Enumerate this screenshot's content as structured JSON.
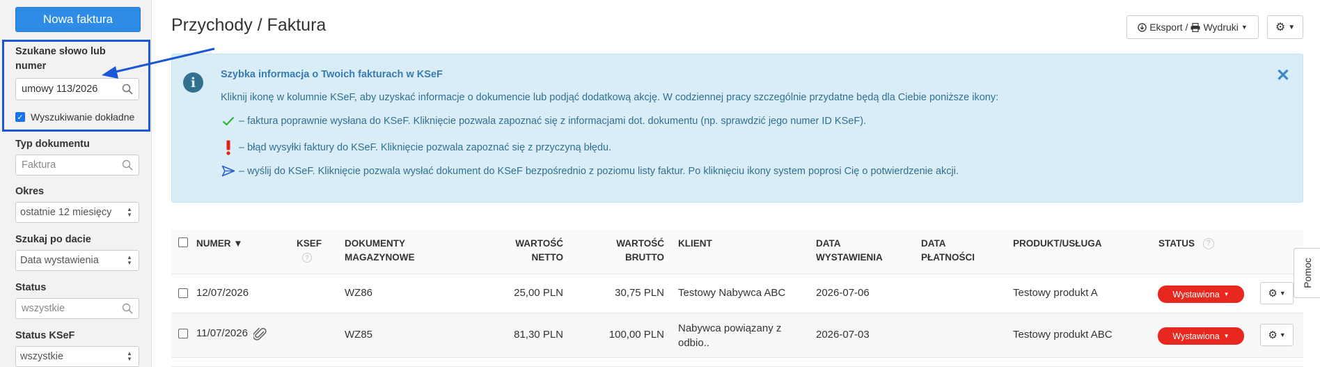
{
  "sidebar": {
    "new_invoice_label": "Nowa faktura",
    "search": {
      "label_line1": "Szukane słowo lub",
      "label_line2": "numer",
      "value": "umowy 113/2026",
      "exact_label": "Wyszukiwanie dokładne",
      "exact_checked": true
    },
    "doc_type": {
      "label": "Typ dokumentu",
      "placeholder": "Faktura"
    },
    "period": {
      "label": "Okres",
      "value": "ostatnie 12 miesięcy"
    },
    "date_search": {
      "label": "Szukaj po dacie",
      "value": "Data wystawienia"
    },
    "status": {
      "label": "Status",
      "placeholder": "wszystkie"
    },
    "ksef_status": {
      "label": "Status KSeF",
      "value": "wszystkie"
    }
  },
  "header": {
    "title": "Przychody / Faktura",
    "export_label": "Eksport / ",
    "print_label": "Wydruki"
  },
  "info": {
    "title": "Szybka informacja o Twoich fakturach w KSeF",
    "intro": "Kliknij ikonę w kolumnie KSeF, aby uzyskać informacje o dokumencie lub podjąć dodatkową akcję. W codziennej pracy szczególnie przydatne będą dla Ciebie poniższe ikony:",
    "line_ok": "– faktura poprawnie wysłana do KSeF. Kliknięcie pozwala zapoznać się z informacjami dot. dokumentu (np. sprawdzić jego numer ID KSeF).",
    "line_error": "– błąd wysyłki faktury do KSeF. Kliknięcie pozwala zapoznać się z przyczyną błędu.",
    "line_send": "– wyślij do KSeF. Kliknięcie pozwala wysłać dokument do KSeF bezpośrednio z poziomu listy faktur. Po kliknięciu ikony system poprosi Cię o potwierdzenie akcji.",
    "colors": {
      "ok": "#2fb52f",
      "error": "#e0201a",
      "send": "#2a5bd7"
    }
  },
  "table": {
    "headers": {
      "numer": "NUMER ▼",
      "ksef": "KSEF",
      "dok_line1": "DOKUMENTY",
      "dok_line2": "MAGAZYNOWE",
      "netto_line1": "WARTOŚĆ",
      "netto_line2": "NETTO",
      "brutto_line1": "WARTOŚĆ",
      "brutto_line2": "BRUTTO",
      "klient": "KLIENT",
      "data_wyst_line1": "DATA",
      "data_wyst_line2": "WYSTAWIENIA",
      "data_plat_line1": "DATA",
      "data_plat_line2": "PŁATNOŚCI",
      "produkt": "PRODUKT/USŁUGA",
      "status": "STATUS"
    },
    "rows": [
      {
        "numer": "12/07/2026",
        "dok": "WZ86",
        "netto": "25,00 PLN",
        "brutto": "30,75 PLN",
        "klient_line1": "Testowy Nabywca ABC",
        "klient_line2": "",
        "data_wyst": "2026-07-06",
        "produkt": "Testowy produkt A",
        "status": "Wystawiona",
        "attachment": false
      },
      {
        "numer": "11/07/2026",
        "dok": "WZ85",
        "netto": "81,30 PLN",
        "brutto": "100,00 PLN",
        "klient_line1": "Nabywca powiązany z",
        "klient_line2": "odbio..",
        "data_wyst": "2026-07-03",
        "produkt": "Testowy produkt ABC",
        "status": "Wystawiona",
        "attachment": true
      }
    ]
  },
  "help_tab_label": "Pomoc",
  "colors": {
    "primary": "#2e8ce6",
    "status_red": "#e8281e",
    "highlight": "#1a56d6",
    "info_bg": "#d9edf7"
  }
}
